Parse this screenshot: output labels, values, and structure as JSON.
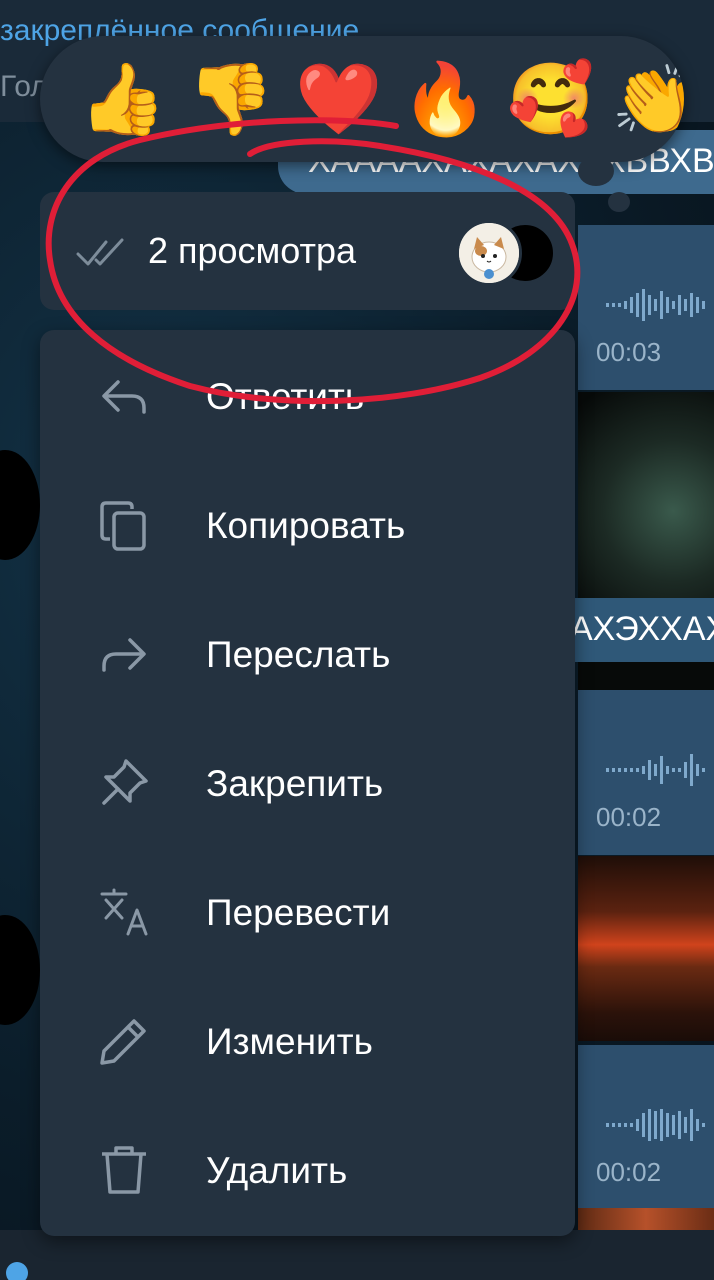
{
  "pinned": {
    "title": "закреплённое сообщение",
    "subtitle": "Гол"
  },
  "reactions": [
    {
      "emoji": "👍",
      "name": "thumbs-up-icon"
    },
    {
      "emoji": "👎",
      "name": "thumbs-down-icon"
    },
    {
      "emoji": "❤️",
      "name": "heart-icon"
    },
    {
      "emoji": "🔥",
      "name": "fire-icon"
    },
    {
      "emoji": "🥰",
      "name": "smiling-hearts-icon"
    },
    {
      "emoji": "👏",
      "name": "clapping-icon"
    }
  ],
  "views": {
    "label": "2 просмотра"
  },
  "menu": {
    "items": [
      {
        "label": "Ответить",
        "icon": "reply-icon"
      },
      {
        "label": "Копировать",
        "icon": "copy-icon"
      },
      {
        "label": "Переслать",
        "icon": "forward-icon"
      },
      {
        "label": "Закрепить",
        "icon": "pin-icon"
      },
      {
        "label": "Перевести",
        "icon": "translate-icon"
      },
      {
        "label": "Изменить",
        "icon": "edit-icon"
      },
      {
        "label": "Удалить",
        "icon": "delete-icon"
      }
    ]
  },
  "chat": {
    "messages": [
      {
        "text": "ХААААХАХАХАХАХВВХВ"
      },
      {
        "text": "АХЭХХАХ"
      }
    ],
    "voice_durations": [
      "00:03",
      "00:02",
      "00:02"
    ]
  },
  "colors": {
    "menu_bg": "#243240",
    "accent_blue": "#4ea4e6",
    "annotation_red": "#e01e37"
  }
}
